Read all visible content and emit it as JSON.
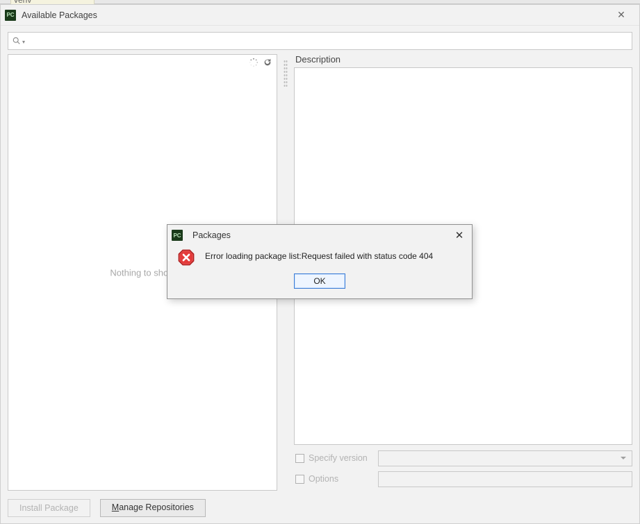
{
  "topFragment": "venv",
  "dialog": {
    "title": "Available Packages",
    "search": {
      "placeholder": ""
    },
    "left": {
      "emptyText": "Nothing to show"
    },
    "right": {
      "descriptionLabel": "Description",
      "specifyVersionLabel": "Specify version",
      "optionsLabel": "Options"
    },
    "footer": {
      "installLabel": "Install Package",
      "manageLabel_pre": "",
      "manageLabel_ul": "M",
      "manageLabel_post": "anage Repositories"
    }
  },
  "modal": {
    "title": "Packages",
    "message": "Error loading package list:Request failed with status code 404",
    "okLabel": "OK"
  }
}
